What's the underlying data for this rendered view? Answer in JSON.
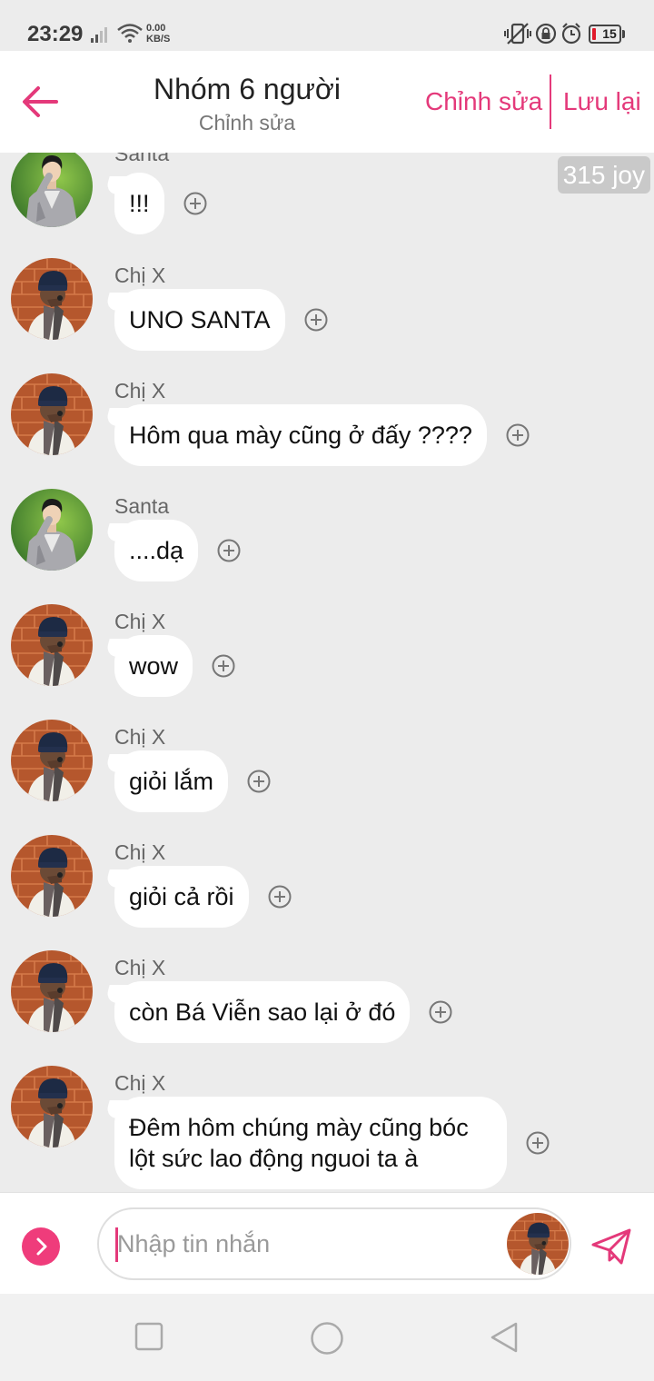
{
  "status_bar": {
    "time": "23:29",
    "net_speed_value": "0.00",
    "net_speed_unit": "KB/S",
    "battery_level": "15",
    "battery_color": "#e01a2b"
  },
  "header": {
    "title": "Nhóm 6 người",
    "subtitle": "Chỉnh sửa",
    "edit_label": "Chỉnh sửa",
    "save_label": "Lưu lại",
    "accent_color": "#e4397a"
  },
  "joy_badge": "315 joy",
  "messages": [
    {
      "sender": "Santa",
      "text": "!!!",
      "avatar": "santa-avatar"
    },
    {
      "sender": "Chị X",
      "text": "UNO SANTA",
      "avatar": "chi-x-avatar"
    },
    {
      "sender": "Chị X",
      "text": "Hôm qua mày cũng ở đấy ????",
      "avatar": "chi-x-avatar"
    },
    {
      "sender": "Santa",
      "text": "....dạ",
      "avatar": "santa-avatar"
    },
    {
      "sender": "Chị X",
      "text": "wow",
      "avatar": "chi-x-avatar"
    },
    {
      "sender": "Chị X",
      "text": "giỏi lắm",
      "avatar": "chi-x-avatar"
    },
    {
      "sender": "Chị X",
      "text": "giỏi cả rồi",
      "avatar": "chi-x-avatar"
    },
    {
      "sender": "Chị X",
      "text": "còn Bá Viễn sao lại ở đó",
      "avatar": "chi-x-avatar"
    },
    {
      "sender": "Chị X",
      "text": "Đêm hôm chúng mày cũng bóc lột sức lao động nguoi ta à",
      "avatar": "chi-x-avatar"
    }
  ],
  "composer": {
    "placeholder": "Nhập tin nhắn",
    "value": ""
  },
  "icons": {
    "back": "arrow-left-icon",
    "react": "plus-circle-icon",
    "expand": "chevron-right-icon",
    "send": "paper-plane-icon",
    "nav_recent": "square-icon",
    "nav_home": "circle-icon",
    "nav_back": "triangle-back-icon"
  }
}
